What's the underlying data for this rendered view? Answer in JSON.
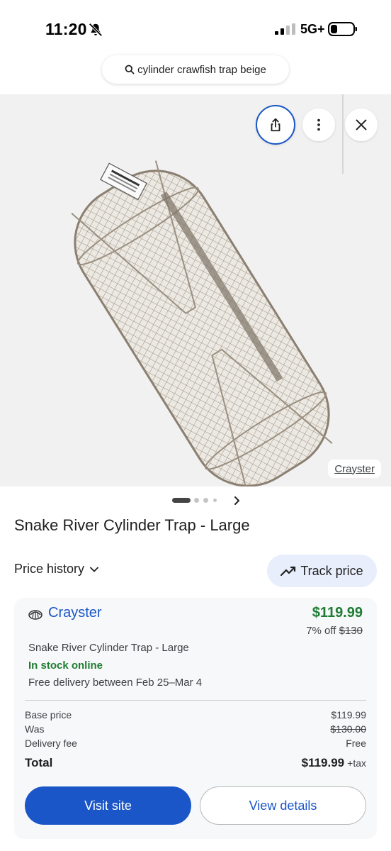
{
  "status_bar": {
    "time": "11:20",
    "network": "5G+"
  },
  "search": {
    "query": "cylinder crawfish trap beige"
  },
  "image": {
    "attribution": "Crayster",
    "carousel_active_index": 0
  },
  "product": {
    "title": "Snake River Cylinder Trap - Large"
  },
  "price_history": {
    "label": "Price history"
  },
  "track_price": {
    "label": "Track price"
  },
  "offer": {
    "seller": "Crayster",
    "price": "$119.99",
    "discount_text": "7% off",
    "original_price": "$130",
    "title": "Snake River Cylinder Trap - Large",
    "stock": "In stock online",
    "delivery": "Free delivery between Feb 25–Mar 4",
    "breakdown": {
      "base_label": "Base price",
      "base_value": "$119.99",
      "was_label": "Was",
      "was_value": "$130.00",
      "fee_label": "Delivery fee",
      "fee_value": "Free",
      "total_label": "Total",
      "total_value": "$119.99",
      "tax_text": "+tax"
    },
    "visit_label": "Visit site",
    "details_label": "View details"
  },
  "colors": {
    "accent_blue": "#1a56c7",
    "price_green": "#1e7d32",
    "track_bg": "#e8eefb"
  },
  "icons": [
    "bell-off-icon",
    "signal-icon",
    "battery-icon",
    "search-icon",
    "share-icon",
    "more-vert-icon",
    "close-icon",
    "chevron-right-icon",
    "chevron-down-icon",
    "trending-up-icon",
    "crayfish-logo-icon"
  ]
}
